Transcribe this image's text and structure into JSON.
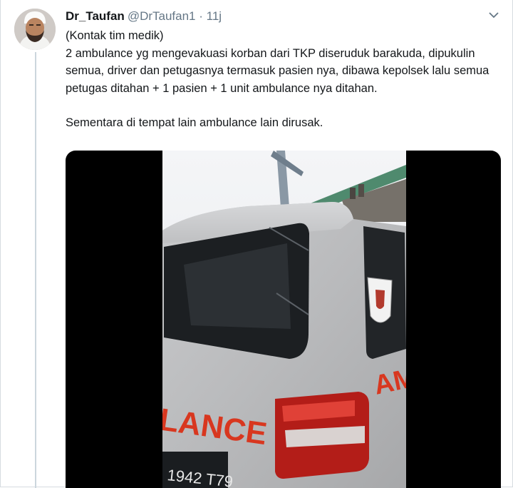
{
  "tweet": {
    "display_name": "Dr_Taufan",
    "handle": "@DrTaufan1",
    "separator": " · ",
    "time": "11j",
    "lines": [
      "(Kontak tim medik)",
      "2 ambulance yg mengevakuasi korban dari TKP diseruduk barakuda, dipukulin semua, driver dan petugasnya termasuk pasien nya, dibawa kepolsek lalu semua petugas ditahan + 1 pasien + 1 unit ambulance nya ditahan.",
      "Sementara di tempat lain ambulance lain dirusak."
    ]
  },
  "video": {
    "van_text": "LANCE",
    "side_text": "AM",
    "plate": "1942  T79"
  },
  "colors": {
    "text": "#14171a",
    "muted": "#657786",
    "border": "#d6dbe0",
    "thread": "#ccd6dd",
    "ambulance_red": "#d8371f"
  },
  "icons": [
    "avatar",
    "chevron-down-icon"
  ]
}
